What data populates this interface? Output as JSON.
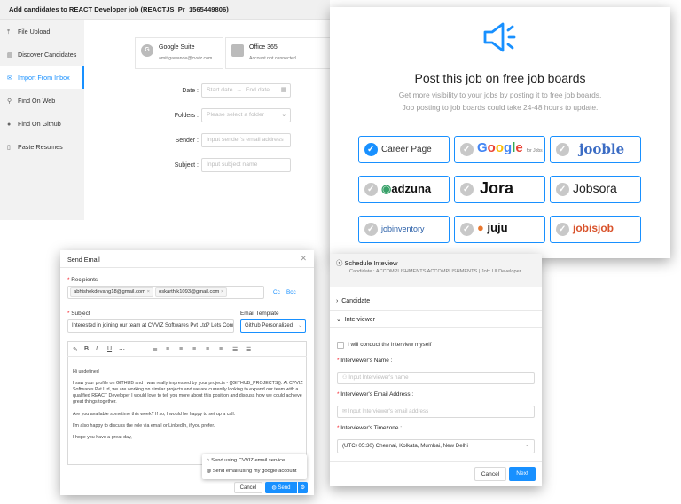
{
  "add_candidates": {
    "title": "Add candidates to REACT Developer job (REACTJS_Pr_1565449806)",
    "sidebar": [
      {
        "label": "File Upload",
        "icon": "upload-icon"
      },
      {
        "label": "Discover Candidates",
        "icon": "document-icon"
      },
      {
        "label": "Import From Inbox",
        "icon": "mail-icon",
        "active": true
      },
      {
        "label": "Find On Web",
        "icon": "search-icon"
      },
      {
        "label": "Find On Github",
        "icon": "github-icon"
      },
      {
        "label": "Paste Resumes",
        "icon": "paste-icon"
      }
    ],
    "accounts": [
      {
        "name": "Google Suite",
        "detail": "amit.gawande@cvviz.com",
        "glyph": "G"
      },
      {
        "name": "Office 365",
        "detail": "Account not connected"
      }
    ],
    "date_label": "Date :",
    "date_start_placeholder": "Start date",
    "date_end_placeholder": "End date",
    "folders_label": "Folders :",
    "folders_placeholder": "Please select a folder",
    "sender_label": "Sender :",
    "sender_placeholder": "Input sender's email address",
    "subject_label": "Subject :",
    "subject_placeholder": "Input subject name"
  },
  "post_job": {
    "title": "Post this job on free job boards",
    "subtitle_1": "Get more visibility to your jobs by posting it to free job boards.",
    "subtitle_2": "Job posting to job boards could take 24-48 hours to update.",
    "boards": [
      {
        "name": "Career Page",
        "selected": true
      },
      {
        "name": "Google",
        "suffix": "for Jobs",
        "selected": false
      },
      {
        "name": "jooble",
        "selected": false
      },
      {
        "name": "adzuna",
        "selected": false
      },
      {
        "name": "Jora",
        "selected": false
      },
      {
        "name": "Jobsora",
        "selected": false
      },
      {
        "name": "jobinventory",
        "selected": false
      },
      {
        "name": "juju",
        "selected": false
      },
      {
        "name": "jobisjob",
        "selected": false
      }
    ],
    "colors": {
      "accent": "#1890ff"
    }
  },
  "send_email": {
    "title": "Send Email",
    "recipients_label": "Recipients",
    "recipients": [
      "abhishekdevang18@gmail.com",
      "oskarthik1093@gmail.com"
    ],
    "cc": "Cc",
    "bcc": "Bcc",
    "subject_label": "Subject",
    "subject_value": "Interested in joining our team at CVVIZ Softwares Pvt Ltd? Lets Conn",
    "template_label": "Email Template",
    "template_value": "Github Personalized",
    "body": [
      "Hi undefined",
      "I saw your profile on GITHUB and I was really impressed by your projects - {{GITHUB_PROJECTS}}. At CVVIZ Softwares Pvt Ltd, we are working on similar projects and we are currently looking to expand our team with a qualified REACT Developer I would love to tell you more about this position and discuss how we could achieve great things together.",
      "Are you available sometime this week? If so, I would be happy to set up a call.",
      "I'm also happy to discuss the role via email or LinkedIn, if you prefer.",
      "I hope you have a great day,"
    ],
    "send_options": [
      "Send using CVVIZ email service",
      "Send email using my google account"
    ],
    "cancel": "Cancel",
    "send": "Send"
  },
  "schedule": {
    "title": "Schedule Inteview",
    "subtitle": "Candidate : ACCOMPLISHMENTS ACCOMPLISHMENTS | Job: UI Developer",
    "candidate_section": "Candidate",
    "interviewer_section": "Interviewer",
    "self_checkbox": "I will conduct the interview myself",
    "name_label": "Interviewer's Name :",
    "name_placeholder": "Input Interviewer's name",
    "email_label": "Interviewer's Email Address :",
    "email_placeholder": "Input Interviewer's email address",
    "tz_label": "Interviewer's Timezone :",
    "tz_value": "(UTC+05:30) Chennai, Kolkata, Mumbai, New Delhi",
    "cancel": "Cancel",
    "next": "Next"
  }
}
